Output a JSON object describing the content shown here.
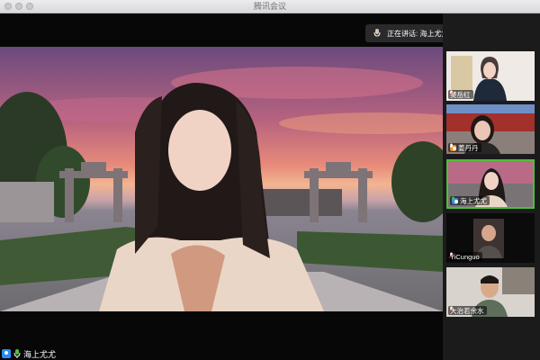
{
  "window": {
    "title": "腾讯会议"
  },
  "speaking_banner": {
    "text": "正在讲话: 海上尤尤;"
  },
  "main_video": {
    "name": "海上尤尤"
  },
  "participants": [
    {
      "name": "樊岳红"
    },
    {
      "name": "姜丹丹"
    },
    {
      "name": "海上尤尤"
    },
    {
      "name": "YiCunguo"
    },
    {
      "name": "大治若余水"
    }
  ],
  "colors": {
    "active_speaker_border": "#4fbf3a",
    "host_icon": "#2d8cf0"
  }
}
